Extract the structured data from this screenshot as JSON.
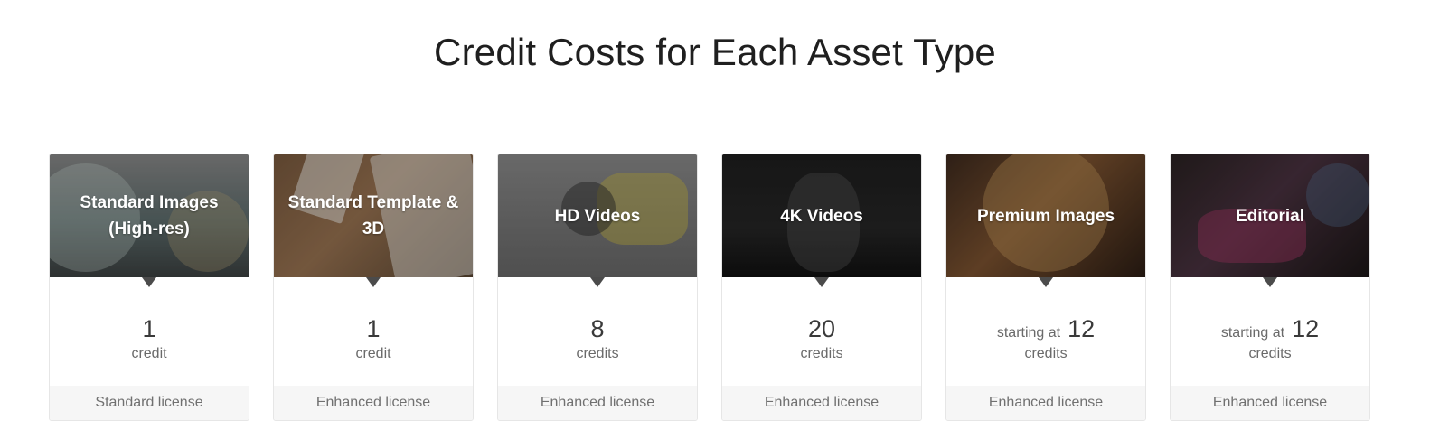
{
  "page": {
    "title": "Credit Costs for Each Asset Type"
  },
  "cards": [
    {
      "title": "Standard Images (High-res)",
      "prefix": "",
      "amount": "1",
      "unit": "credit",
      "license": "Standard license"
    },
    {
      "title": "Standard Template & 3D",
      "prefix": "",
      "amount": "1",
      "unit": "credit",
      "license": "Enhanced license"
    },
    {
      "title": "HD Videos",
      "prefix": "",
      "amount": "8",
      "unit": "credits",
      "license": "Enhanced license"
    },
    {
      "title": "4K Videos",
      "prefix": "",
      "amount": "20",
      "unit": "credits",
      "license": "Enhanced license"
    },
    {
      "title": "Premium Images",
      "prefix": "starting at",
      "amount": "12",
      "unit": "credits",
      "license": "Enhanced license"
    },
    {
      "title": "Editorial",
      "prefix": "starting at",
      "amount": "12",
      "unit": "credits",
      "license": "Enhanced license"
    }
  ],
  "colors": {
    "pointer": "#4b4b4b",
    "footer_bg": "#f6f6f6",
    "text_dark": "#3a3a3a",
    "text_muted": "#6a6a6a"
  }
}
